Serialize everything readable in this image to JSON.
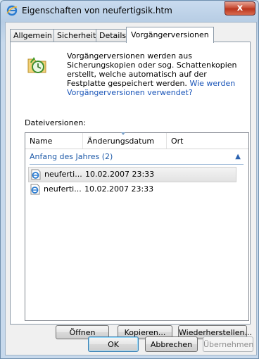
{
  "window": {
    "title": "Eigenschaften von neufertigsik.htm",
    "close_label": "x"
  },
  "tabs": [
    {
      "label": "Allgemein"
    },
    {
      "label": "Sicherheit"
    },
    {
      "label": "Details"
    },
    {
      "label": "Vorgängerversionen"
    }
  ],
  "panel": {
    "intro_text": "Vorgängerversionen werden aus Sicherungskopien oder sog. Schattenkopien erstellt, welche automatisch auf der Festplatte gespeichert werden.",
    "intro_link": "Wie werden Vorgängerversionen verwendet?",
    "file_versions_label": "Dateiversionen:",
    "columns": [
      "Name",
      "Änderungsdatum",
      "Ort"
    ],
    "group_label": "Anfang des Jahres (2)",
    "rows": [
      {
        "name": "neuferti...",
        "date": "10.02.2007 23:33",
        "location": ""
      },
      {
        "name": "neuferti...",
        "date": "10.02.2007 23:33",
        "location": ""
      }
    ],
    "buttons": {
      "open": "Öffnen",
      "copy": "Kopieren...",
      "restore": "Wiederherstellen..."
    }
  },
  "footer": {
    "ok": "OK",
    "cancel": "Abbrechen",
    "apply": "Übernehmen"
  }
}
